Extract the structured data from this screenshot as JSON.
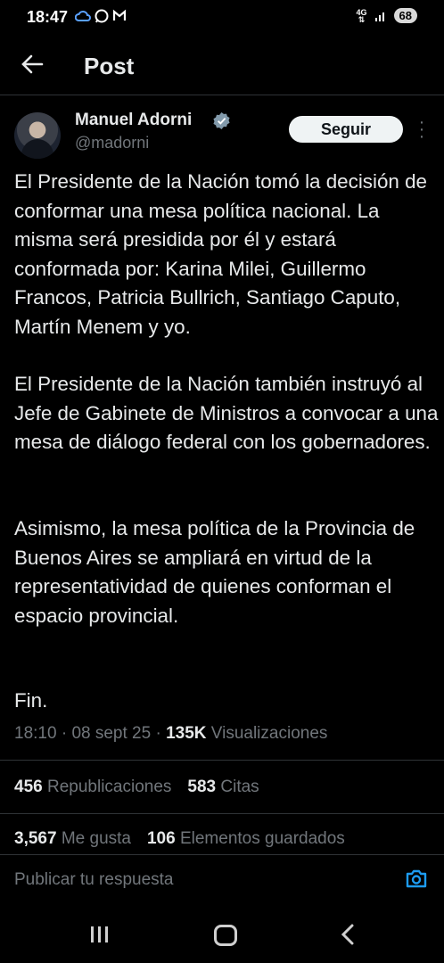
{
  "status_bar": {
    "time": "18:47",
    "network": "4G",
    "battery": "68"
  },
  "header": {
    "title": "Post"
  },
  "author": {
    "name": "Manuel Adorni",
    "handle": "@madorni",
    "follow_label": "Seguir",
    "verified_color": "#829aab"
  },
  "post": {
    "paragraphs": [
      "El Presidente de la Nación tomó la decisión de conformar una mesa política nacional. La misma será presidida por él y estará conformada por: Karina Milei, Guillermo Francos, Patricia Bullrich, Santiago Caputo, Martín Menem y yo.",
      "El Presidente de la Nación también instruyó al Jefe de Gabinete de Ministros a convocar a una mesa de diálogo federal con los gobernadores.",
      "Asimismo, la mesa política de la Provincia de Buenos Aires se ampliará en virtud de la representatividad de quienes conforman el espacio provincial.",
      "Fin."
    ],
    "time": "18:10",
    "date": "08 sept 25",
    "views_count": "135K",
    "views_label": "Visualizaciones"
  },
  "stats": {
    "reposts_count": "456",
    "reposts_label": "Republicaciones",
    "quotes_count": "583",
    "quotes_label": "Citas",
    "likes_count": "3,567",
    "likes_label": "Me gusta",
    "bookmarks_count": "106",
    "bookmarks_label": "Elementos guardados"
  },
  "reply": {
    "placeholder": "Publicar tu respuesta"
  },
  "colors": {
    "accent": "#1d9bf0",
    "background": "#000000",
    "secondary_text": "#71767b"
  }
}
